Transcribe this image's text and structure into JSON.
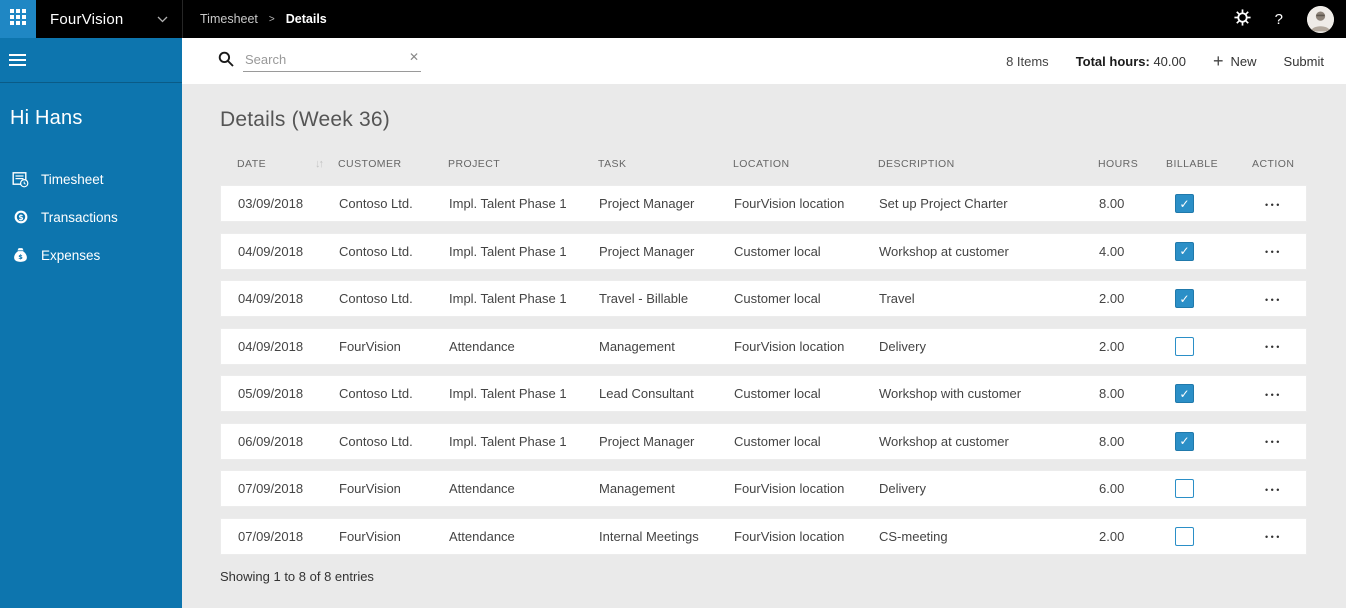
{
  "topbar": {
    "app_name": "FourVision",
    "breadcrumb": {
      "parent": "Timesheet",
      "separator": ">",
      "current": "Details"
    },
    "help_label": "?"
  },
  "sidebar": {
    "greeting": "Hi Hans",
    "items": [
      {
        "label": "Timesheet",
        "icon": "timesheet-icon"
      },
      {
        "label": "Transactions",
        "icon": "transactions-icon"
      },
      {
        "label": "Expenses",
        "icon": "expenses-icon"
      }
    ]
  },
  "toolbar": {
    "search_placeholder": "Search",
    "items_count": "8 Items",
    "total_hours_label": "Total hours:",
    "total_hours_value": "40.00",
    "new_label": "New",
    "submit_label": "Submit"
  },
  "page": {
    "title": "Details (Week 36)",
    "footer": "Showing 1 to 8 of 8 entries"
  },
  "table": {
    "columns": [
      "DATE",
      "CUSTOMER",
      "PROJECT",
      "TASK",
      "LOCATION",
      "DESCRIPTION",
      "HOURS",
      "BILLABLE",
      "ACTION"
    ],
    "rows": [
      {
        "date": "03/09/2018",
        "customer": "Contoso Ltd.",
        "project": "Impl. Talent Phase 1",
        "task": "Project Manager",
        "location": "FourVision location",
        "description": "Set up Project Charter",
        "hours": "8.00",
        "billable": true
      },
      {
        "date": "04/09/2018",
        "customer": "Contoso Ltd.",
        "project": "Impl. Talent Phase 1",
        "task": "Project Manager",
        "location": "Customer local",
        "description": "Workshop at customer",
        "hours": "4.00",
        "billable": true
      },
      {
        "date": "04/09/2018",
        "customer": "Contoso Ltd.",
        "project": "Impl. Talent Phase 1",
        "task": "Travel - Billable",
        "location": "Customer local",
        "description": "Travel",
        "hours": "2.00",
        "billable": true
      },
      {
        "date": "04/09/2018",
        "customer": "FourVision",
        "project": "Attendance",
        "task": "Management",
        "location": "FourVision location",
        "description": "Delivery",
        "hours": "2.00",
        "billable": false
      },
      {
        "date": "05/09/2018",
        "customer": "Contoso Ltd.",
        "project": "Impl. Talent Phase 1",
        "task": "Lead Consultant",
        "location": "Customer local",
        "description": "Workshop with customer",
        "hours": "8.00",
        "billable": true
      },
      {
        "date": "06/09/2018",
        "customer": "Contoso Ltd.",
        "project": "Impl. Talent Phase 1",
        "task": "Project Manager",
        "location": "Customer local",
        "description": "Workshop at customer",
        "hours": "8.00",
        "billable": true
      },
      {
        "date": "07/09/2018",
        "customer": "FourVision",
        "project": "Attendance",
        "task": "Management",
        "location": "FourVision location",
        "description": "Delivery",
        "hours": "6.00",
        "billable": false
      },
      {
        "date": "07/09/2018",
        "customer": "FourVision",
        "project": "Attendance",
        "task": "Internal Meetings",
        "location": "FourVision location",
        "description": "CS-meeting",
        "hours": "2.00",
        "billable": false
      }
    ]
  },
  "icons": {
    "sort": "↓↑",
    "close": "✕",
    "plus": "+",
    "check": "✓",
    "ellipsis": "•••"
  },
  "colors": {
    "topbar_black": "#000000",
    "tile_blue": "#1f87c4",
    "sidebar_blue": "#0d75ae",
    "checkbox_blue": "#2b8fc7",
    "content_bg": "#eaeaea",
    "row_white": "#ffffff"
  }
}
